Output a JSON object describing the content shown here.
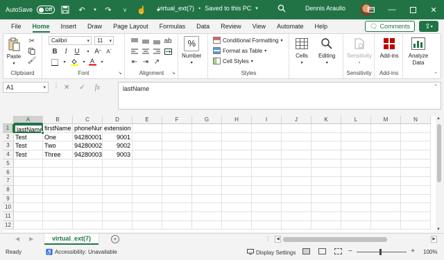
{
  "titlebar": {
    "autosave_label": "AutoSave",
    "autosave_state": "Off",
    "file_name": "virtual_ext(7)",
    "save_status": "Saved to this PC",
    "user_name": "Dennis Araullo",
    "accent_color": "#217346"
  },
  "menu": {
    "tabs": [
      "File",
      "Home",
      "Insert",
      "Draw",
      "Page Layout",
      "Formulas",
      "Data",
      "Review",
      "View",
      "Automate",
      "Help"
    ],
    "active_tab": "Home",
    "comments_label": "Comments"
  },
  "ribbon": {
    "clipboard": {
      "label": "Clipboard",
      "paste": "Paste"
    },
    "font": {
      "label": "Font",
      "name": "Calibri",
      "size": "11"
    },
    "alignment": {
      "label": "Alignment"
    },
    "number": {
      "label": "Number"
    },
    "styles": {
      "label": "Styles",
      "conditional": "Conditional Formatting",
      "format_table": "Format as Table",
      "cell_styles": "Cell Styles"
    },
    "cells": {
      "label": "Cells"
    },
    "editing": {
      "label": "Editing"
    },
    "sensitivity": {
      "label": "Sensitivity",
      "btn": "Sensitivity"
    },
    "addins": {
      "label": "Add-ins",
      "btn": "Add-ins"
    },
    "analyze": {
      "btn_line1": "Analyze",
      "btn_line2": "Data"
    }
  },
  "formula_bar": {
    "name_box": "A1",
    "content": "lastName"
  },
  "grid": {
    "columns": [
      "A",
      "B",
      "C",
      "D",
      "E",
      "F",
      "G",
      "H",
      "I",
      "J",
      "K",
      "L",
      "M",
      "N"
    ],
    "rows": [
      "1",
      "2",
      "3",
      "4",
      "5",
      "6",
      "7",
      "8",
      "9",
      "10",
      "11",
      "12"
    ],
    "data": [
      [
        "lastName",
        "firstName",
        "phoneNum",
        "extension"
      ],
      [
        "Test",
        "One",
        "94280001",
        "9001"
      ],
      [
        "Test",
        "Two",
        "94280002",
        "9002"
      ],
      [
        "Test",
        "Three",
        "94280003",
        "9003"
      ]
    ],
    "active_cell": "A1"
  },
  "sheets": {
    "tabs": [
      "virtual_ext(7)"
    ],
    "active": "virtual_ext(7)"
  },
  "status": {
    "ready": "Ready",
    "accessibility": "Accessibility: Unavailable",
    "display_settings": "Display Settings",
    "zoom": "100%"
  }
}
